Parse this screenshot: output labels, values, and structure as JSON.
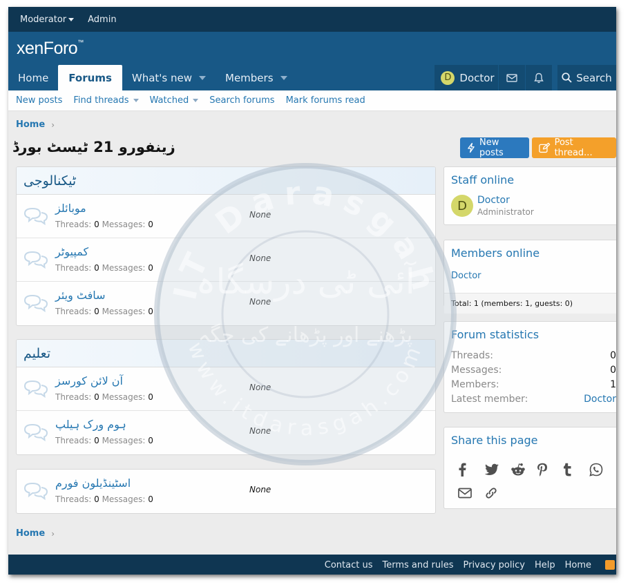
{
  "colors": {
    "header": "#185886",
    "staffbar": "#0f3652",
    "link": "#2577b1",
    "accent_orange": "#f4a02a",
    "button_blue": "#2c79be"
  },
  "staffbar": {
    "moderator": "Moderator",
    "admin": "Admin"
  },
  "logo": {
    "text": "xenForo",
    "mark": "™"
  },
  "nav": {
    "tabs": [
      {
        "label": "Home"
      },
      {
        "label": "Forums"
      },
      {
        "label": "What's new"
      },
      {
        "label": "Members"
      }
    ],
    "user": {
      "initial": "D",
      "name": "Doctor"
    },
    "search_label": "Search",
    "icons": [
      "envelope-icon",
      "bell-icon",
      "search-icon"
    ]
  },
  "subnav": {
    "items": [
      "New posts",
      "Find threads",
      "Watched",
      "Search forums",
      "Mark forums read"
    ]
  },
  "breadcrumb": {
    "label": "Home"
  },
  "page_title": "زینفورو 21 ٹیسٹ بورڈ",
  "buttons": {
    "new_posts": "New posts",
    "post_thread": "Post thread..."
  },
  "categories": [
    {
      "title": "ٹیکنالوجی",
      "nodes": [
        {
          "title": "موبائلز",
          "threads": "0",
          "messages": "0",
          "last": "None"
        },
        {
          "title": "کمپیوٹر",
          "threads": "0",
          "messages": "0",
          "last": "None"
        },
        {
          "title": "سافٹ ویئر",
          "threads": "0",
          "messages": "0",
          "last": "None"
        }
      ]
    },
    {
      "title": "تعلیم",
      "nodes": [
        {
          "title": "آن لائن کورسز",
          "threads": "0",
          "messages": "0",
          "last": "None"
        },
        {
          "title": "ہوم ورک ہیلپ",
          "threads": "0",
          "messages": "0",
          "last": "None"
        }
      ]
    }
  ],
  "standalone": {
    "title": "اسٹینڈیلون فورم",
    "threads": "0",
    "messages": "0",
    "last": "None"
  },
  "stat_labels": {
    "threads": "Threads:",
    "messages": "Messages:"
  },
  "sidebar": {
    "staff_online": {
      "title": "Staff online",
      "member": {
        "initial": "D",
        "name": "Doctor",
        "role": "Administrator"
      }
    },
    "members_online": {
      "title": "Members online",
      "name": "Doctor",
      "total": "Total: 1 (members: 1, guests: 0)"
    },
    "forum_statistics": {
      "title": "Forum statistics",
      "rows": [
        {
          "label": "Threads:",
          "value": "0"
        },
        {
          "label": "Messages:",
          "value": "0"
        },
        {
          "label": "Members:",
          "value": "1"
        },
        {
          "label": "Latest member:",
          "value": "Doctor"
        }
      ]
    },
    "share": {
      "title": "Share this page",
      "icons": [
        "facebook-icon",
        "twitter-icon",
        "reddit-icon",
        "pinterest-icon",
        "tumblr-icon",
        "whatsapp-icon",
        "email-icon",
        "link-icon"
      ]
    }
  },
  "footer": {
    "links": [
      "Contact us",
      "Terms and rules",
      "Privacy policy",
      "Help",
      "Home"
    ]
  },
  "watermark": {
    "top": "IT Darasgah",
    "urdu_main": "آئی ٹی درسگاہ",
    "urdu_tagline": "پڑھنے اور پڑھانے کی جگہ",
    "bottom": "www.itdarasgah.com"
  }
}
